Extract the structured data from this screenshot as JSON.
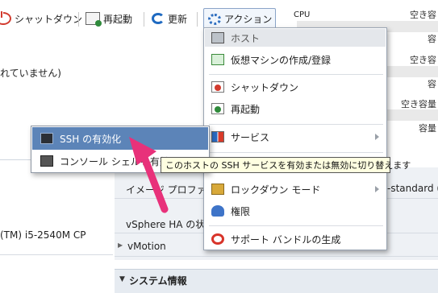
{
  "toolbar": {
    "shutdown_label": "シャットダウン",
    "reboot_label": "再起動",
    "refresh_label": "更新",
    "actions_label": "アクション"
  },
  "background": {
    "not_configured_fragment": "れていません)",
    "cpu_label": "CPU",
    "cpu_model_fragment": "(TM) i5-2540M CP",
    "image_profile_label": "イメージ プロファ",
    "image_profile_value": "-standard (V",
    "vsphere_ha_label": "vSphere HA の状態",
    "vmotion_label": "vMotion",
    "system_info_label": "システム情報",
    "capacity_labels": [
      "空き容",
      "容",
      "空き容",
      "容",
      "空き容量",
      "容量"
    ]
  },
  "action_menu": {
    "header": "ホスト",
    "items": [
      {
        "label": "仮想マシンの作成/登録",
        "icon": "vm-create-icon"
      },
      {
        "label": "シャットダウン",
        "icon": "shutdown-icon"
      },
      {
        "label": "再起動",
        "icon": "reboot-icon"
      },
      {
        "label": "サービス",
        "icon": "services-icon"
      },
      {
        "label": "ロックダウン モード",
        "icon": "lockdown-icon"
      },
      {
        "label": "権限",
        "icon": "permissions-icon"
      },
      {
        "label": "サポート バンドルの生成",
        "icon": "support-bundle-icon"
      }
    ]
  },
  "services_submenu": {
    "items": [
      {
        "label": "SSH の有効化",
        "selected": true
      },
      {
        "label": "コンソール シェルを有効",
        "selected": false
      }
    ]
  },
  "tooltip": {
    "text": "このホストの SSH サービスを有効または無効に切り替えます"
  },
  "colors": {
    "selection": "#5c84b8",
    "annotation_arrow": "#e8317a",
    "tooltip_bg": "#ffffe1"
  }
}
